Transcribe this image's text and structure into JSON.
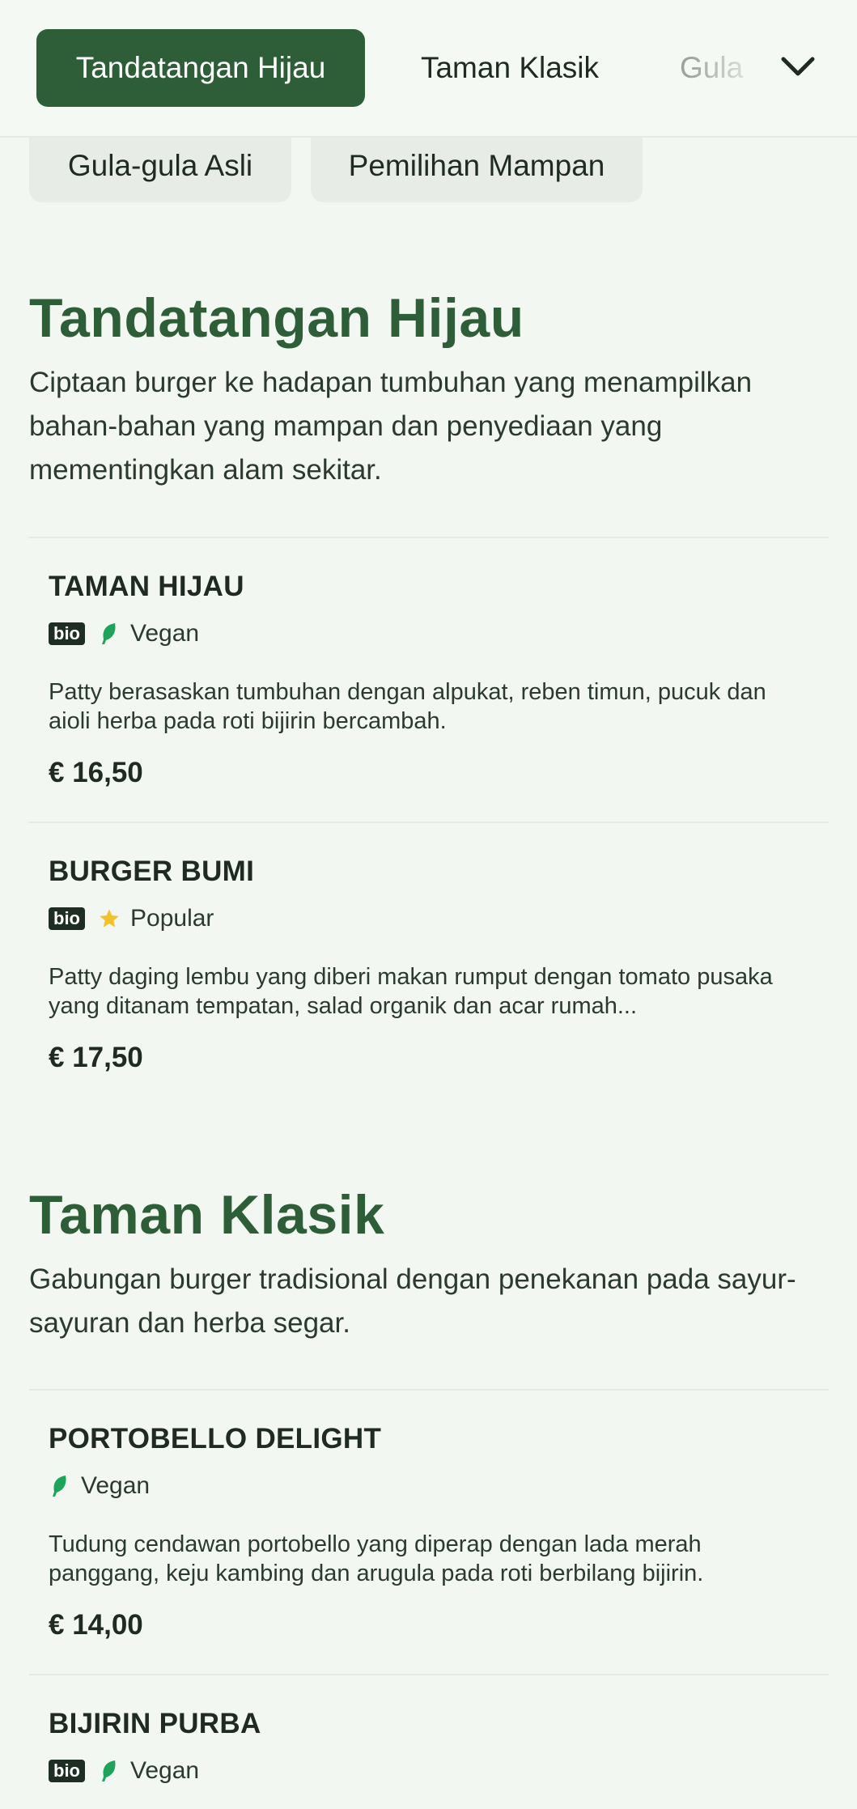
{
  "tabs": {
    "active": "Tandatangan Hijau",
    "second": "Taman Klasik",
    "third_partial": "Gula"
  },
  "chips": [
    "Gula-gula Asli",
    "Pemilihan Mampan"
  ],
  "sections": [
    {
      "title": "Tandatangan Hijau",
      "description": "Ciptaan burger ke hadapan tumbuhan yang menampilkan bahan-bahan yang mampan dan penyediaan yang mementingkan alam sekitar.",
      "items": [
        {
          "name": "TAMAN HIJAU",
          "bio": "bio",
          "tag_icon": "leaf-icon",
          "tag": "Vegan",
          "description": "Patty berasaskan tumbuhan dengan alpukat, reben timun, pucuk dan aioli herba pada roti bijirin bercambah.",
          "price": "€ 16,50"
        },
        {
          "name": "BURGER BUMI",
          "bio": "bio",
          "tag_icon": "star-icon",
          "tag": "Popular",
          "description": "Patty daging lembu yang diberi makan rumput dengan tomato pusaka yang ditanam tempatan, salad organik dan acar rumah...",
          "price": "€ 17,50"
        }
      ]
    },
    {
      "title": "Taman Klasik",
      "description": "Gabungan burger tradisional dengan penekanan pada sayur-sayuran dan herba segar.",
      "items": [
        {
          "name": "PORTOBELLO DELIGHT",
          "tag_icon": "leaf-icon",
          "tag": "Vegan",
          "description": "Tudung cendawan portobello yang diperap dengan lada merah panggang, keju kambing dan arugula pada roti berbilang bijirin.",
          "price": "€ 14,00"
        },
        {
          "name": "BIJIRIN PURBA",
          "bio": "bio",
          "tag_icon": "leaf-icon",
          "tag": "Vegan"
        }
      ]
    }
  ],
  "colors": {
    "accent": "#2e5e38",
    "background": "#f3f7f1",
    "leaf": "#1fa35a",
    "star": "#f2c12e"
  }
}
